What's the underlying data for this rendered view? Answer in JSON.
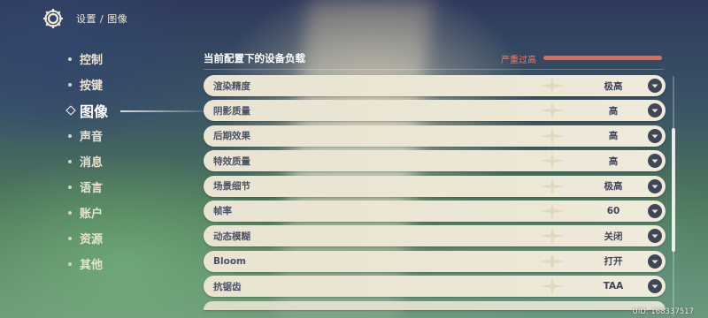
{
  "header": {
    "breadcrumb": "设置 / 图像",
    "icon": "gear-icon"
  },
  "sidebar": {
    "items": [
      {
        "label": "控制",
        "active": false
      },
      {
        "label": "按键",
        "active": false
      },
      {
        "label": "图像",
        "active": true
      },
      {
        "label": "声音",
        "active": false
      },
      {
        "label": "消息",
        "active": false
      },
      {
        "label": "语言",
        "active": false
      },
      {
        "label": "账户",
        "active": false
      },
      {
        "label": "资源",
        "active": false
      },
      {
        "label": "其他",
        "active": false
      }
    ]
  },
  "panel": {
    "title": "当前配置下的设备负载",
    "load_label": "严重过高",
    "load_color": "#e06b53",
    "settings": [
      {
        "label": "渲染精度",
        "value": "极高"
      },
      {
        "label": "阴影质量",
        "value": "高"
      },
      {
        "label": "后期效果",
        "value": "高"
      },
      {
        "label": "特效质量",
        "value": "高"
      },
      {
        "label": "场景细节",
        "value": "极高"
      },
      {
        "label": "帧率",
        "value": "60"
      },
      {
        "label": "动态模糊",
        "value": "关闭"
      },
      {
        "label": "Bloom",
        "value": "打开"
      },
      {
        "label": "抗锯齿",
        "value": "TAA"
      }
    ]
  },
  "footer": {
    "uid": "UID: 168337517"
  }
}
